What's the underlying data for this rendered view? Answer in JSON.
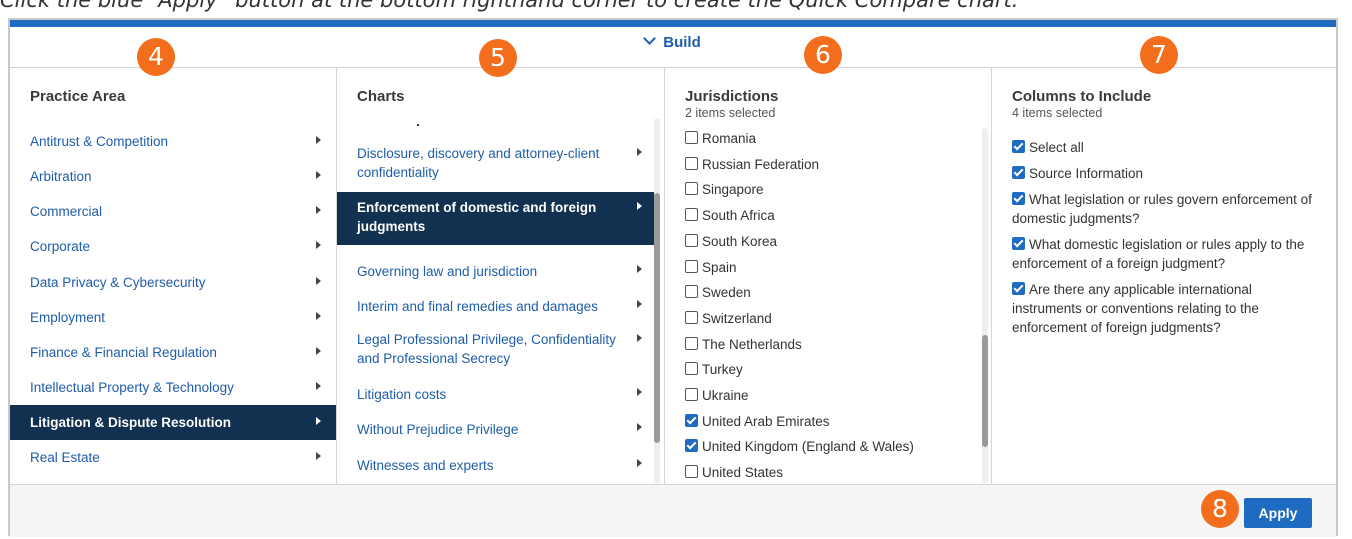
{
  "caption": "Click the blue “Apply” button at the bottom righthand corner to create the Quick Compare chart.",
  "build_label": "Build",
  "badges": [
    "4",
    "5",
    "6",
    "7",
    "8"
  ],
  "practice_area": {
    "title": "Practice Area",
    "items": [
      {
        "label": "Antitrust & Competition"
      },
      {
        "label": "Arbitration"
      },
      {
        "label": "Commercial"
      },
      {
        "label": "Corporate"
      },
      {
        "label": "Data Privacy & Cybersecurity"
      },
      {
        "label": "Employment"
      },
      {
        "label": "Finance & Financial Regulation"
      },
      {
        "label": "Intellectual Property & Technology"
      },
      {
        "label": "Litigation & Dispute Resolution"
      },
      {
        "label": "Real Estate"
      }
    ],
    "selected_index": 8
  },
  "charts": {
    "title": "Charts",
    "items": [
      {
        "label": "Disclosure, discovery and attorney-client confidentiality"
      },
      {
        "label": "Enforcement of domestic and foreign judgments"
      },
      {
        "label": "Governing law and jurisdiction"
      },
      {
        "label": "Interim and final remedies and damages"
      },
      {
        "label": "Legal Professional Privilege, Confidentiality and Professional Secrecy"
      },
      {
        "label": "Litigation costs"
      },
      {
        "label": "Without Prejudice Privilege"
      },
      {
        "label": "Witnesses and experts"
      }
    ],
    "selected_index": 1,
    "scroll_position": 0.65
  },
  "jurisdictions": {
    "title": "Jurisdictions",
    "subtitle": "2 items selected",
    "items": [
      {
        "label": "Romania",
        "checked": false
      },
      {
        "label": "Russian Federation",
        "checked": false
      },
      {
        "label": "Singapore",
        "checked": false
      },
      {
        "label": "South Africa",
        "checked": false
      },
      {
        "label": "South Korea",
        "checked": false
      },
      {
        "label": "Spain",
        "checked": false
      },
      {
        "label": "Sweden",
        "checked": false
      },
      {
        "label": "Switzerland",
        "checked": false
      },
      {
        "label": "The Netherlands",
        "checked": false
      },
      {
        "label": "Turkey",
        "checked": false
      },
      {
        "label": "Ukraine",
        "checked": false
      },
      {
        "label": "United Arab Emirates",
        "checked": true
      },
      {
        "label": "United Kingdom (England & Wales)",
        "checked": true
      },
      {
        "label": "United States",
        "checked": false
      }
    ],
    "scroll_position": 0.85
  },
  "columns": {
    "title": "Columns to Include",
    "subtitle": "4 items selected",
    "items": [
      {
        "label": "Select all",
        "checked": true
      },
      {
        "label": "Source Information",
        "checked": true
      },
      {
        "label": "What legislation or rules govern enforcement of domestic judgments?",
        "checked": true
      },
      {
        "label": "What domestic legislation or rules apply to the enforcement of a foreign judgment?",
        "checked": true
      },
      {
        "label": "Are there any applicable international instruments or conventions relating to the enforcement of foreign judgments?",
        "checked": true
      }
    ]
  },
  "apply_label": "Apply",
  "colors": {
    "accent": "#1e6bc2",
    "selected": "#12304f",
    "badge": "#f26d1c"
  }
}
